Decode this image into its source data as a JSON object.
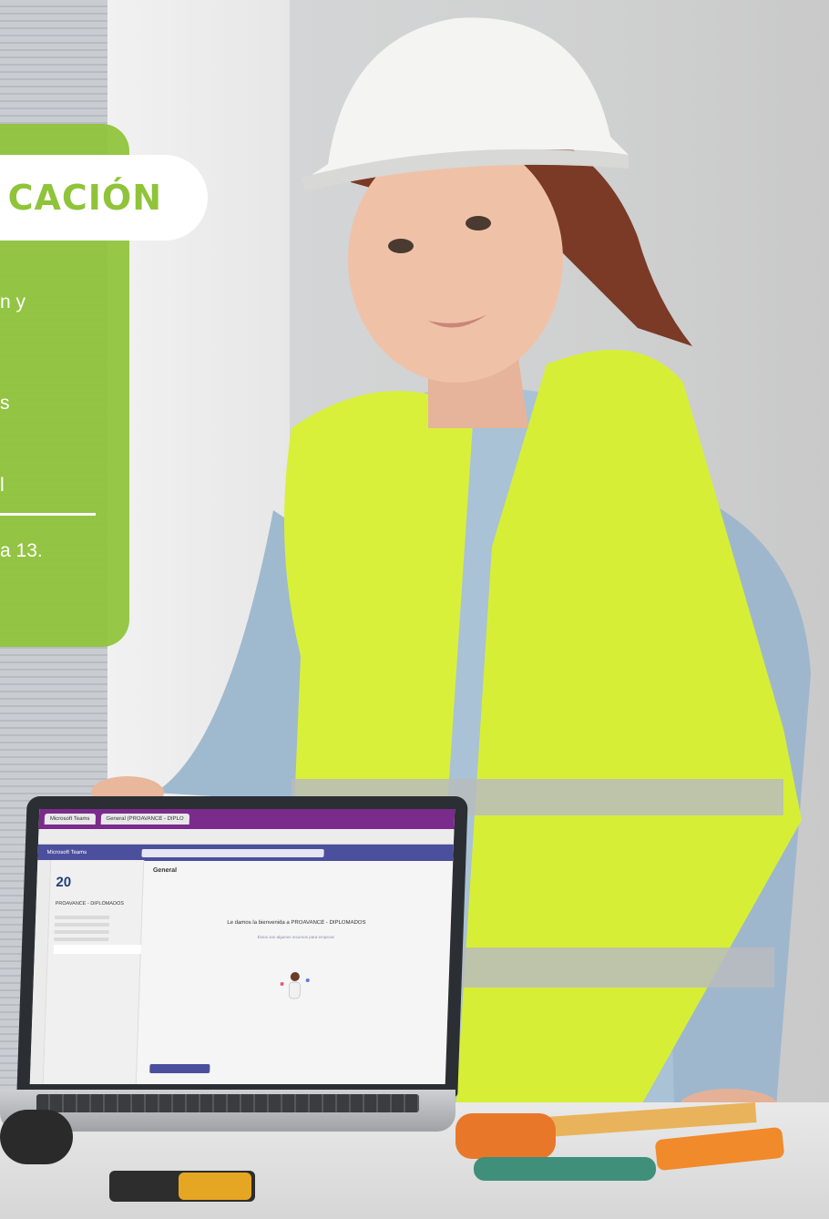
{
  "banner": {
    "title": "CACIÓN",
    "fragments": [
      "n y",
      "s",
      "l",
      "a 13."
    ]
  },
  "laptop": {
    "browser_tab_1": "Microsoft Teams",
    "browser_tab_2": "General (PROAVANCE - DIPLO",
    "app_name": "Microsoft Teams",
    "team_name": "PROAVANCE - DIPLOMADOS",
    "team_logo": "20",
    "channel_header": "General",
    "welcome_text": "Le damos la bienvenida a PROAVANCE - DIPLOMADOS",
    "welcome_subtext": "Estos son algunos recursos para empezar"
  },
  "colors": {
    "accent_green": "#8fc43a",
    "teams_purple": "#4b4f9e",
    "vest_yellow": "#d9f03a"
  }
}
